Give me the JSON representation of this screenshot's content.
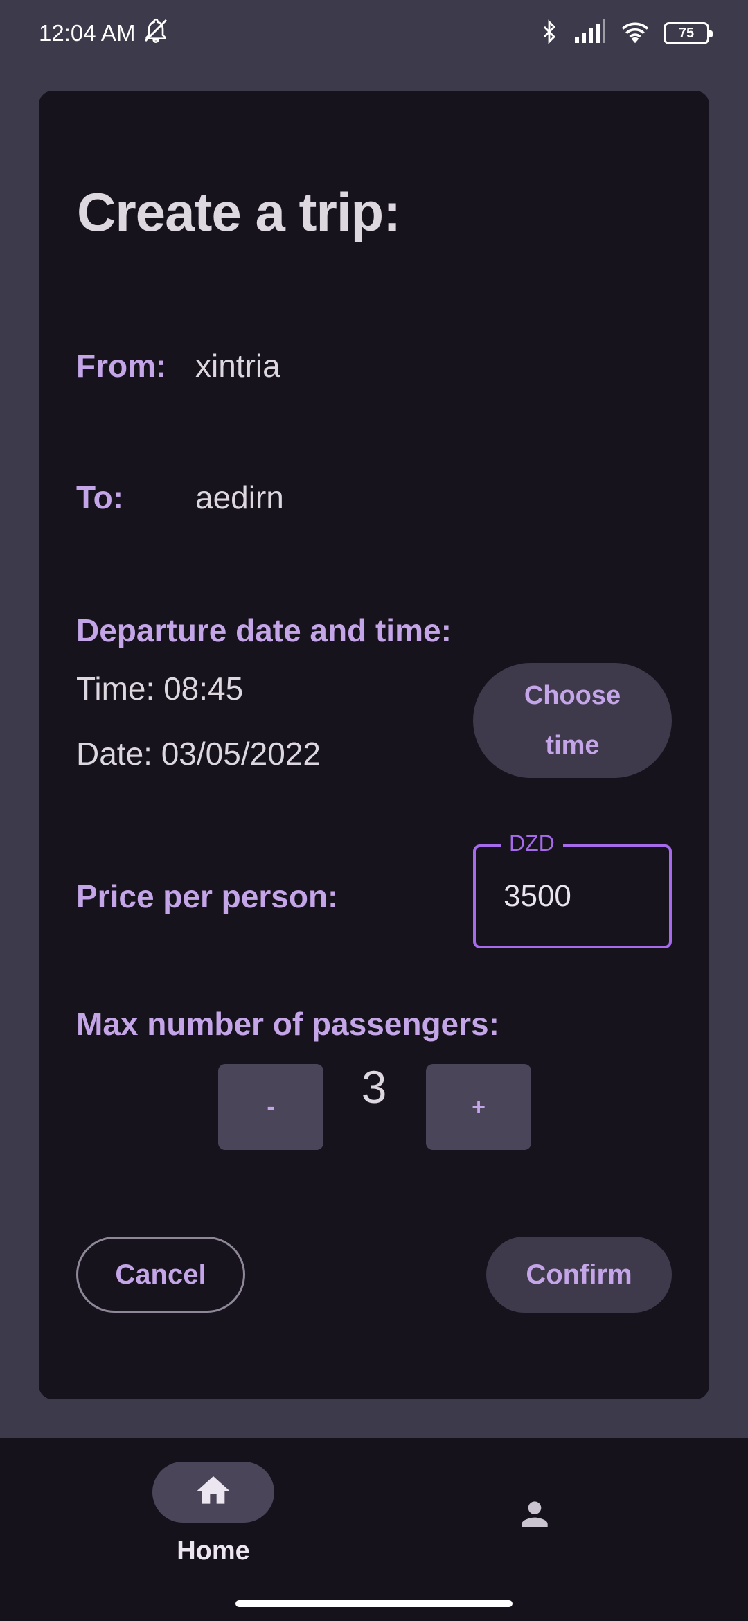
{
  "status_bar": {
    "time": "12:04 AM",
    "battery": "75",
    "icons": [
      "alarm-off-icon",
      "bluetooth-icon",
      "signal-icon",
      "wifi-icon",
      "battery-icon"
    ]
  },
  "form": {
    "title": "Create a trip:",
    "from_label": "From:",
    "from_value": "xintria",
    "to_label": "To:",
    "to_value": "aedirn",
    "departure_label": "Departure date and time:",
    "time_text": "Time: 08:45",
    "date_text": "Date: 03/05/2022",
    "choose_time_label": "Choose time",
    "price_label": "Price per person:",
    "price_currency": "DZD",
    "price_value": "3500",
    "passengers_label": "Max number of passengers:",
    "decrement_label": "-",
    "passenger_count": "3",
    "increment_label": "+",
    "cancel_label": "Cancel",
    "confirm_label": "Confirm"
  },
  "bottom_nav": {
    "home_label": "Home",
    "home_icon": "home-icon",
    "profile_icon": "person-icon"
  },
  "colors": {
    "accent": "#c4a6e8",
    "field_border": "#a56bea",
    "card_bg": "#17131d",
    "page_bg": "#3d3a4b"
  }
}
